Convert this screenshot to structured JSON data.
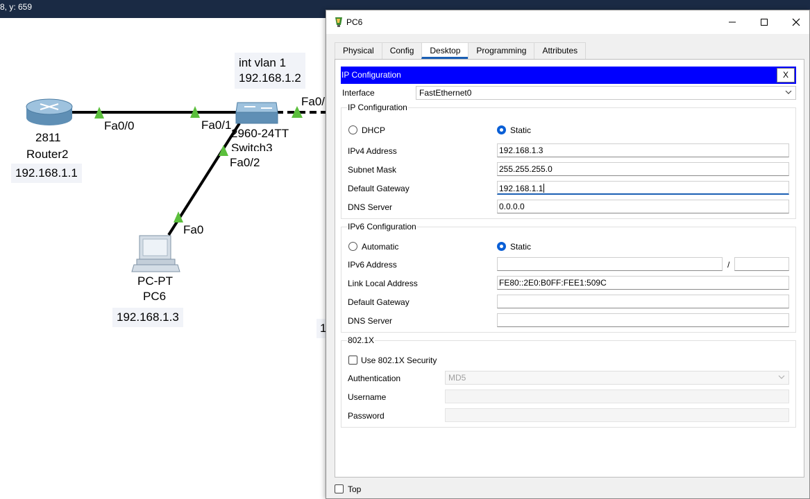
{
  "statusbar": {
    "coords": "8, y: 659"
  },
  "topology": {
    "router": {
      "model": "2811",
      "name": "Router2",
      "ip": "192.168.1.1"
    },
    "switch": {
      "annot_line1": "int vlan 1",
      "annot_line2": "192.168.1.2",
      "model": "2960-24TT",
      "name": "Switch3"
    },
    "pc": {
      "model": "PC-PT",
      "name": "PC6",
      "ip": "192.168.1.3"
    },
    "ports": {
      "router_fa00": "Fa0/0",
      "switch_fa01": "Fa0/1",
      "switch_fa02": "Fa0/2",
      "pc_fa0": "Fa0",
      "switch_right": "Fa0/"
    },
    "partial_label": "1"
  },
  "window": {
    "title": "PC6",
    "tabs": [
      "Physical",
      "Config",
      "Desktop",
      "Programming",
      "Attributes"
    ],
    "active_tab": "Desktop",
    "header": "IP Configuration",
    "close_label": "X",
    "interface_label": "Interface",
    "interface_value": "FastEthernet0",
    "ipv4": {
      "title": "IP Configuration",
      "dhcp_label": "DHCP",
      "static_label": "Static",
      "selected": "Static",
      "ipv4_label": "IPv4 Address",
      "ipv4_value": "192.168.1.3",
      "mask_label": "Subnet Mask",
      "mask_value": "255.255.255.0",
      "gateway_label": "Default Gateway",
      "gateway_value": "192.168.1.1",
      "dns_label": "DNS Server",
      "dns_value": "0.0.0.0"
    },
    "ipv6": {
      "title": "IPv6 Configuration",
      "auto_label": "Automatic",
      "static_label": "Static",
      "selected": "Static",
      "addr_label": "IPv6 Address",
      "addr_value": "",
      "prefix_sep": "/",
      "prefix_value": "",
      "linklocal_label": "Link Local Address",
      "linklocal_value": "FE80::2E0:B0FF:FEE1:509C",
      "gateway_label": "Default Gateway",
      "gateway_value": "",
      "dns_label": "DNS Server",
      "dns_value": ""
    },
    "dot1x": {
      "title": "802.1X",
      "use_label": "Use 802.1X Security",
      "auth_label": "Authentication",
      "auth_value": "MD5",
      "user_label": "Username",
      "pass_label": "Password"
    },
    "top_label": "Top"
  },
  "colors": {
    "header_bar": "#0000ff",
    "active_tab": "#1a5fb4",
    "statusbar": "#1a2a44",
    "link_green": "#5bbf3c"
  }
}
